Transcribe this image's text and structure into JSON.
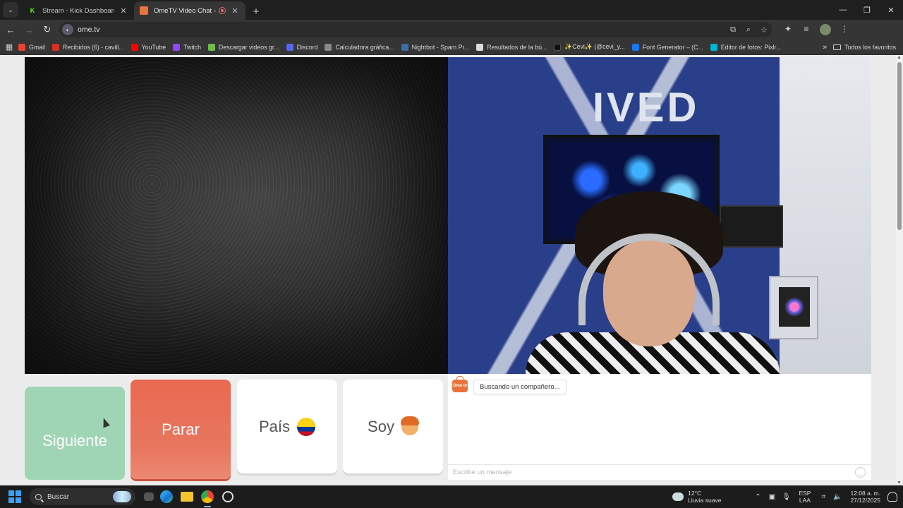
{
  "browser": {
    "tabs": [
      {
        "title": "Stream - Kick Dashboard",
        "favicon_color": "#53fc18",
        "favicon_glyph": "K",
        "active": false
      },
      {
        "title": "OmeTV Video Chat — Ome",
        "favicon_color": "#e8743c",
        "favicon_glyph": "",
        "active": true
      }
    ],
    "address": "ome.tv",
    "bookmarks": [
      {
        "label": "Gmail",
        "color": "#ea4335"
      },
      {
        "label": "Recibidos (6) - cavill...",
        "color": "#d93025"
      },
      {
        "label": "YouTube",
        "color": "#ff0000"
      },
      {
        "label": "Twitch",
        "color": "#9146ff"
      },
      {
        "label": "Descargar videos gr...",
        "color": "#6cc04a"
      },
      {
        "label": "Discord",
        "color": "#5865f2"
      },
      {
        "label": "Calculadora gráfica...",
        "color": "#888888"
      },
      {
        "label": "Nightbot - Spam Pr...",
        "color": "#3a6ea5"
      },
      {
        "label": "Resultados de la bú...",
        "color": "#dddddd"
      },
      {
        "label": "✨Cevi✨ (@cevi_y...",
        "color": "#111111"
      },
      {
        "label": "Font Generator – (C...",
        "color": "#1877f2"
      },
      {
        "label": "Editor de fotos: Pixlr...",
        "color": "#00b4d8"
      }
    ],
    "bookmarks_folder": "Todos los favoritos"
  },
  "controls": {
    "next_label": "Siguiente",
    "stop_label": "Parar",
    "country_label": "País",
    "gender_label": "Soy"
  },
  "stream": {
    "wall_logo": "IVED"
  },
  "chat": {
    "logo_text": "Ome tv",
    "status_message": "Buscando un compañero...",
    "input_placeholder": "Escribe un mensaje"
  },
  "taskbar": {
    "search_label": "Buscar",
    "weather_temp": "12°C",
    "weather_desc": "Lluvia suave",
    "lang_top": "ESP",
    "lang_bottom": "LAA",
    "time": "12:08 a. m.",
    "date": "27/12/2025"
  },
  "colors": {
    "next_button": "#9fd5b5",
    "stop_button": "#e96a50",
    "page_bg": "#ececec"
  }
}
